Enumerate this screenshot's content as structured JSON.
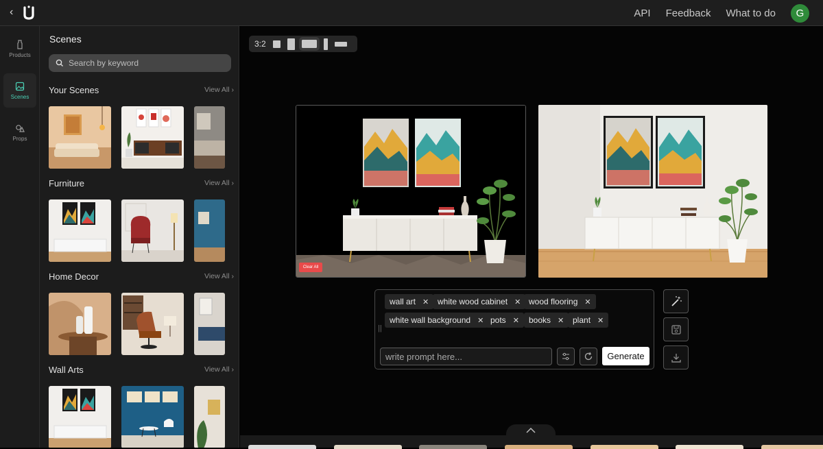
{
  "topbar": {
    "back_label": "‹",
    "logo_letter": "U",
    "nav": [
      "API",
      "Feedback",
      "What to do"
    ],
    "avatar_letter": "G"
  },
  "rail": {
    "items": [
      {
        "label": "Products",
        "icon": "bottle-icon"
      },
      {
        "label": "Scenes",
        "icon": "image-icon",
        "active": true
      },
      {
        "label": "Props",
        "icon": "shapes-icon"
      }
    ]
  },
  "panel": {
    "title": "Scenes",
    "search_placeholder": "Search by keyword",
    "view_all": "View All",
    "sections": [
      {
        "title": "Your Scenes"
      },
      {
        "title": "Furniture"
      },
      {
        "title": "Home Decor"
      },
      {
        "title": "Wall Arts"
      }
    ]
  },
  "workspace": {
    "ratio_label": "3:2",
    "clear_all_label": "Clear All",
    "tags": [
      "wall art",
      "white wood cabinet",
      "wood flooring",
      "white wall background",
      "pots",
      "books",
      "plant"
    ],
    "prompt_placeholder": "write prompt here...",
    "generate_label": "Generate"
  },
  "colors": {
    "accent": "#4bd0b5",
    "avatar": "#2f8b3a",
    "clear": "#e84a4a"
  }
}
